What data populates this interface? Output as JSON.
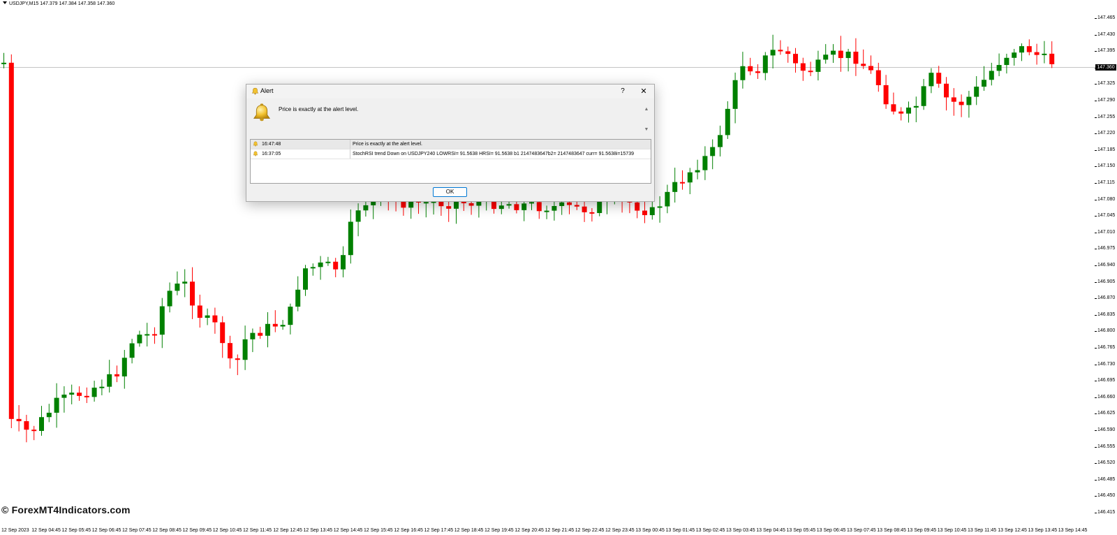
{
  "chart": {
    "header_text": "USDJPY,M15  147.379 147.384 147.358 147.360",
    "current_price": "147.360",
    "up_color": "#008000",
    "down_color": "#ff0000",
    "watermark": "© ForexMT4Indicators.com",
    "price_ticks": [
      "147.465",
      "147.430",
      "147.395",
      "147.360",
      "147.325",
      "147.290",
      "147.255",
      "147.220",
      "147.185",
      "147.150",
      "147.115",
      "147.080",
      "147.045",
      "147.010",
      "146.975",
      "146.940",
      "146.905",
      "146.870",
      "146.835",
      "146.800",
      "146.765",
      "146.730",
      "146.695",
      "146.660",
      "146.625",
      "146.590",
      "146.555",
      "146.520",
      "146.485",
      "146.450",
      "146.415"
    ],
    "time_ticks": [
      "12 Sep 2023",
      "12 Sep 04:45",
      "12 Sep 05:45",
      "12 Sep 06:45",
      "12 Sep 07:45",
      "12 Sep 08:45",
      "12 Sep 09:45",
      "12 Sep 10:45",
      "12 Sep 11:45",
      "12 Sep 12:45",
      "12 Sep 13:45",
      "12 Sep 14:45",
      "12 Sep 15:45",
      "12 Sep 16:45",
      "12 Sep 17:45",
      "12 Sep 18:45",
      "12 Sep 19:45",
      "12 Sep 20:45",
      "12 Sep 21:45",
      "12 Sep 22:45",
      "12 Sep 23:45",
      "13 Sep 00:45",
      "13 Sep 01:45",
      "13 Sep 02:45",
      "13 Sep 03:45",
      "13 Sep 04:45",
      "13 Sep 05:45",
      "13 Sep 06:45",
      "13 Sep 07:45",
      "13 Sep 08:45",
      "13 Sep 09:45",
      "13 Sep 10:45",
      "13 Sep 11:45",
      "13 Sep 12:45",
      "13 Sep 13:45",
      "13 Sep 14:45"
    ]
  },
  "dialog": {
    "title": "Alert",
    "help_label": "?",
    "close_label": "✕",
    "message": "Price is exactly at the alert level.",
    "scroll_up_icon": "triangle-up-icon",
    "scroll_down_icon": "triangle-down-icon",
    "rows": [
      {
        "time": "16:47:48",
        "message": "Price is exactly at the alert level.",
        "selected": true
      },
      {
        "time": "16:37:05",
        "message": "StochRSI trend Down on USDJPY240 LOWRSI= 91.5638 HRSI= 91.5638 b1 2147483647b2= 2147483647 curr= 91.5638i=15739",
        "selected": false
      }
    ],
    "ok_label": "OK",
    "bell_color": "#f2c230"
  }
}
